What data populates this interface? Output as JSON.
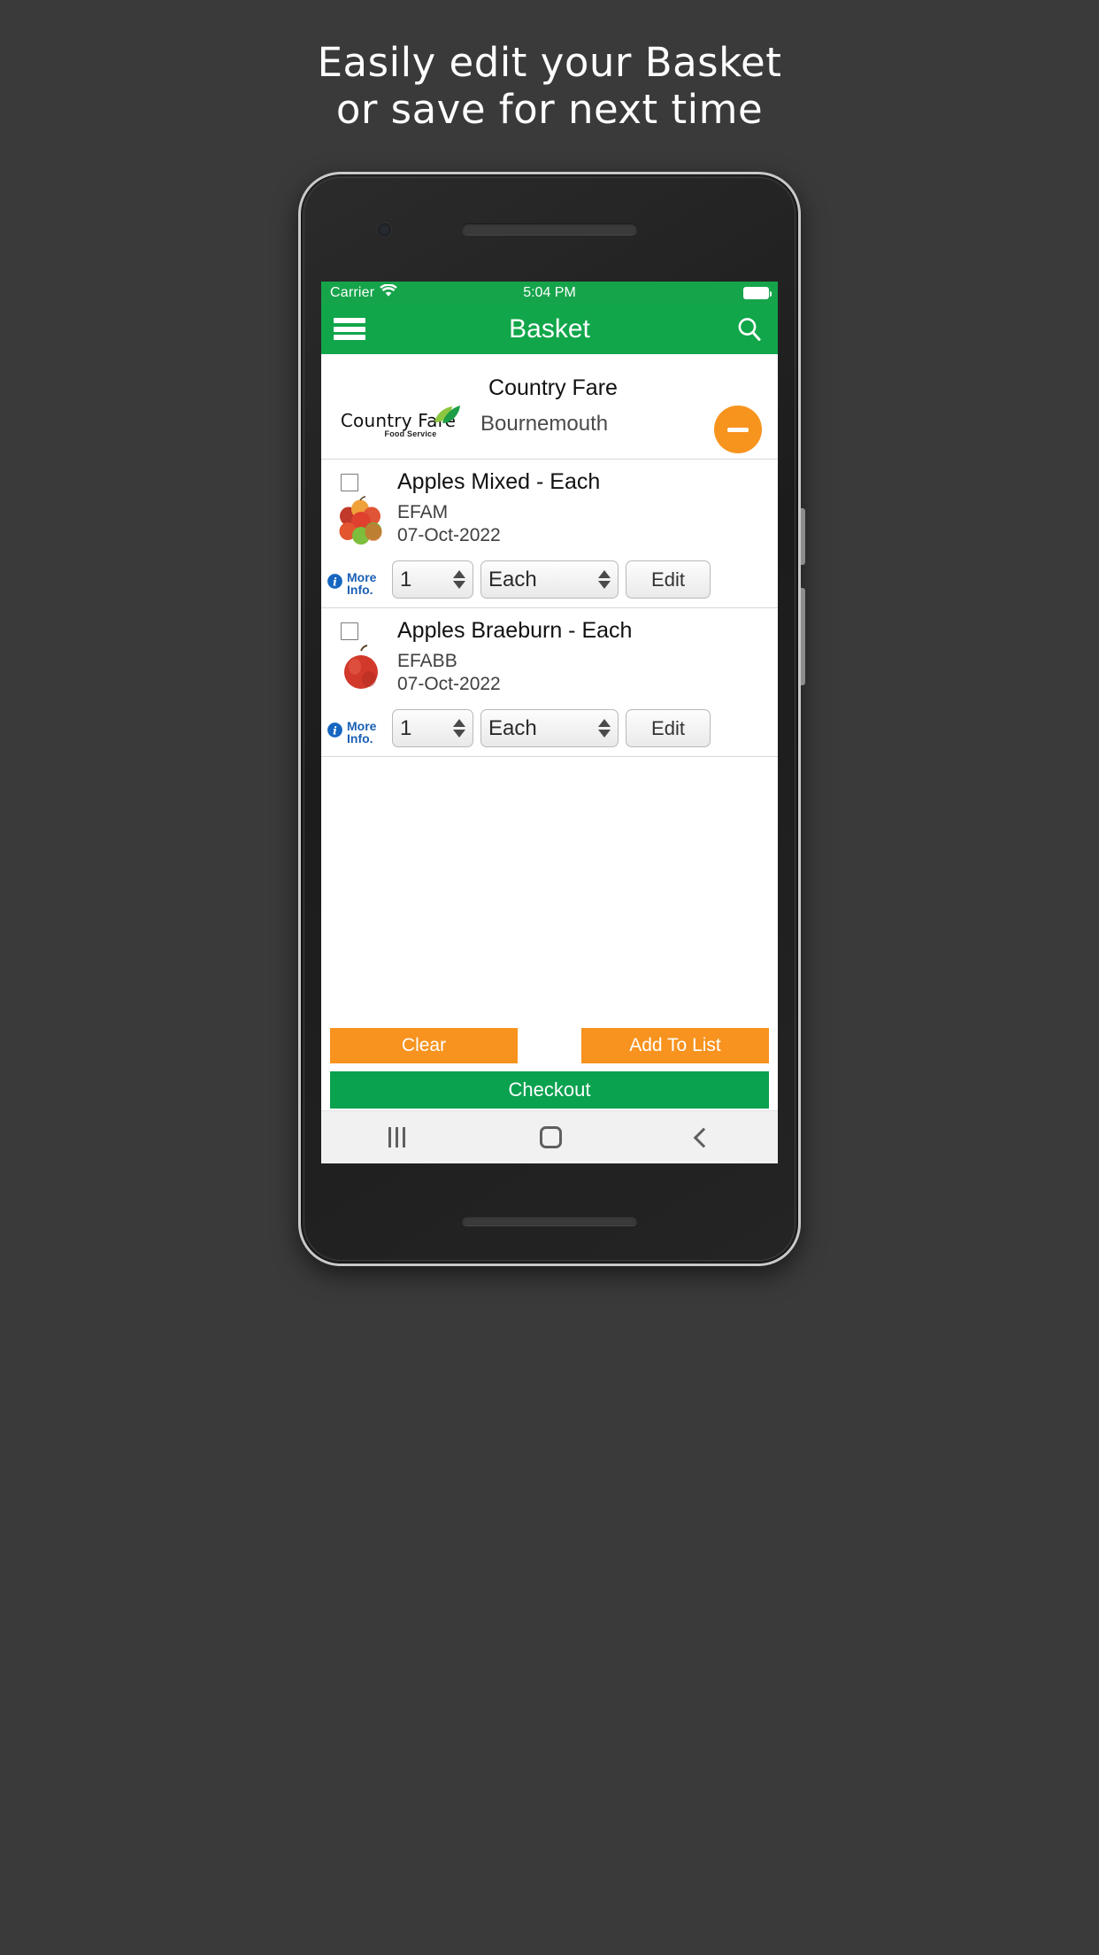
{
  "promo": {
    "line1": "Easily edit your Basket",
    "line2": "or save for next time"
  },
  "status_bar": {
    "carrier": "Carrier",
    "time": "5:04 PM",
    "wifi_icon": "wifi-icon",
    "battery_icon": "battery-full-icon"
  },
  "app_bar": {
    "menu_icon": "hamburger-menu-icon",
    "title": "Basket",
    "search_icon": "search-icon"
  },
  "supplier": {
    "name": "Country Fare",
    "location": "Bournemouth",
    "logo_main": "Country Fare",
    "logo_sub": "Food Service",
    "remove_label": "−"
  },
  "items": [
    {
      "title": "Apples Mixed - Each",
      "code": "EFAM",
      "date": "07-Oct-2022",
      "more_info_line1": "More",
      "more_info_line2": "Info.",
      "quantity": "1",
      "unit": "Each",
      "edit_label": "Edit",
      "thumb_icon": "apples-mixed-image"
    },
    {
      "title": "Apples Braeburn - Each",
      "code": "EFABB",
      "date": "07-Oct-2022",
      "more_info_line1": "More",
      "more_info_line2": "Info.",
      "quantity": "1",
      "unit": "Each",
      "edit_label": "Edit",
      "thumb_icon": "apple-braeburn-image"
    }
  ],
  "actions": {
    "clear": "Clear",
    "add_to_list": "Add To List",
    "checkout": "Checkout"
  },
  "nav_bar": {
    "recents_icon": "recents-icon",
    "home_icon": "home-icon",
    "back_icon": "back-icon"
  },
  "colors": {
    "brand_green": "#11a64a",
    "status_green": "#16a44b",
    "checkout_green": "#0aa14f",
    "accent_orange": "#f7931e",
    "remove_orange": "#f7941e",
    "link_blue": "#1a5fb4",
    "page_background": "#3a3a3a"
  }
}
